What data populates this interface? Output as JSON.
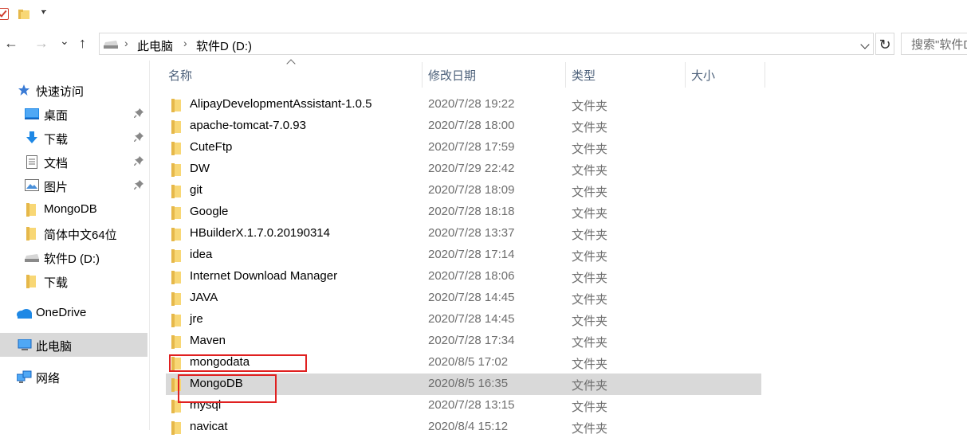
{
  "address": {
    "crumbs": [
      "此电脑",
      "软件D (D:)"
    ],
    "search_placeholder": "搜索\"软件D (D:)\""
  },
  "nav_buttons": {
    "back": "←",
    "forward": "→",
    "recent": "⌄",
    "up": "↑",
    "refresh": "↻"
  },
  "navpane": {
    "quick_access": "快速访问",
    "items": [
      {
        "label": "桌面",
        "icon": "desktop-icon",
        "pinned": true
      },
      {
        "label": "下载",
        "icon": "download-icon",
        "pinned": true
      },
      {
        "label": "文档",
        "icon": "document-icon",
        "pinned": true
      },
      {
        "label": "图片",
        "icon": "picture-icon",
        "pinned": true
      },
      {
        "label": "MongoDB",
        "icon": "folder-icon",
        "pinned": false
      },
      {
        "label": "简体中文64位",
        "icon": "folder-icon",
        "pinned": false
      },
      {
        "label": "软件D (D:)",
        "icon": "drive-icon",
        "pinned": false
      },
      {
        "label": "下载",
        "icon": "folder-icon",
        "pinned": false
      }
    ],
    "onedrive": "OneDrive",
    "this_pc": "此电脑",
    "network": "网络"
  },
  "columns": {
    "name": "名称",
    "date": "修改日期",
    "type": "类型",
    "size": "大小"
  },
  "files": [
    {
      "name": "AlipayDevelopmentAssistant-1.0.5",
      "date": "2020/7/28 19:22",
      "type": "文件夹"
    },
    {
      "name": "apache-tomcat-7.0.93",
      "date": "2020/7/28 18:00",
      "type": "文件夹"
    },
    {
      "name": "CuteFtp",
      "date": "2020/7/28 17:59",
      "type": "文件夹"
    },
    {
      "name": "DW",
      "date": "2020/7/29 22:42",
      "type": "文件夹"
    },
    {
      "name": "git",
      "date": "2020/7/28 18:09",
      "type": "文件夹"
    },
    {
      "name": "Google",
      "date": "2020/7/28 18:18",
      "type": "文件夹"
    },
    {
      "name": "HBuilderX.1.7.0.20190314",
      "date": "2020/7/28 13:37",
      "type": "文件夹"
    },
    {
      "name": "idea",
      "date": "2020/7/28 17:14",
      "type": "文件夹"
    },
    {
      "name": "Internet Download Manager",
      "date": "2020/7/28 18:06",
      "type": "文件夹"
    },
    {
      "name": "JAVA",
      "date": "2020/7/28 14:45",
      "type": "文件夹"
    },
    {
      "name": "jre",
      "date": "2020/7/28 14:45",
      "type": "文件夹"
    },
    {
      "name": "Maven",
      "date": "2020/7/28 17:34",
      "type": "文件夹"
    },
    {
      "name": "mongodata",
      "date": "2020/8/5 17:02",
      "type": "文件夹"
    },
    {
      "name": "MongoDB",
      "date": "2020/8/5 16:35",
      "type": "文件夹",
      "selected": true
    },
    {
      "name": "mysql",
      "date": "2020/7/28 13:15",
      "type": "文件夹"
    },
    {
      "name": "navicat",
      "date": "2020/8/4 15:12",
      "type": "文件夹"
    }
  ],
  "colors": {
    "folder": "#f8d775",
    "folder_dark": "#e6b84a",
    "selection": "#d9d9d9",
    "annotation": "#e02020",
    "header_text": "#4c607a"
  }
}
